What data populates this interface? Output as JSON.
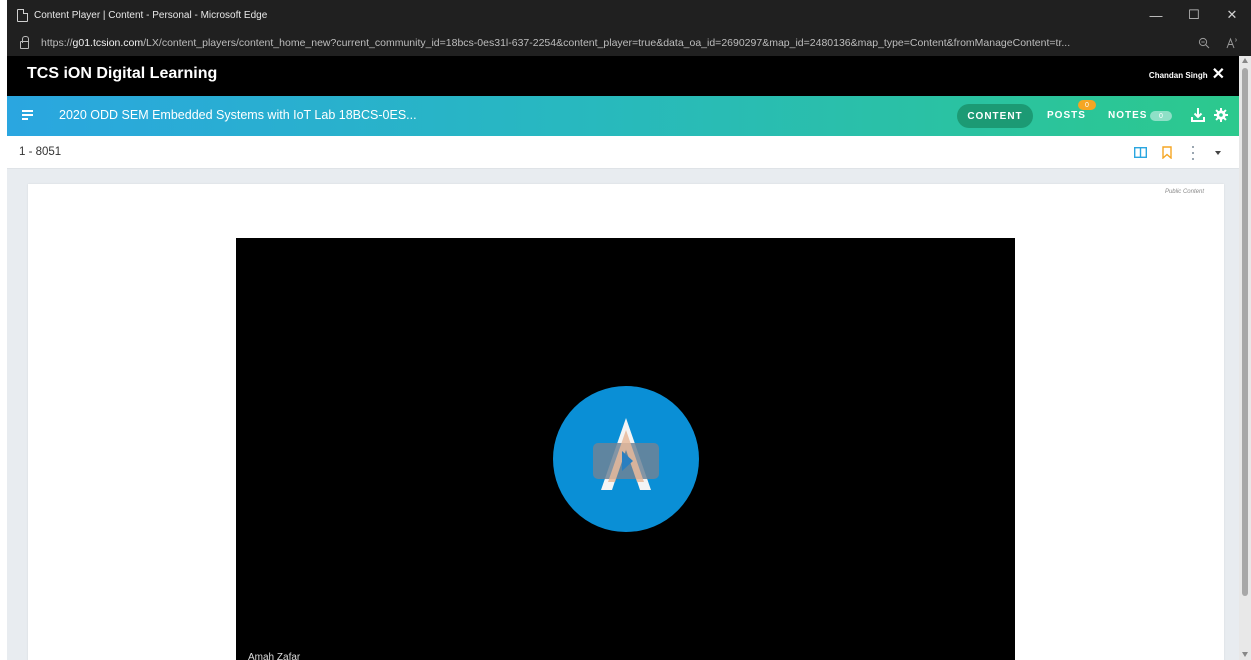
{
  "window": {
    "title": "Content Player | Content - Personal - Microsoft Edge",
    "controls": {
      "minimize": "—",
      "maximize": "☐",
      "close": "✕"
    }
  },
  "address_bar": {
    "url_prefix": "https://",
    "url_host": "g01.tcsion.com",
    "url_rest": "/LX/content_players/content_home_new?current_community_id=18bcs-0es31l-637-2254&content_player=true&data_oa_id=2690297&map_id=2480136&map_type=Content&fromManageContent=tr...",
    "icons": [
      "zoom-icon",
      "read-aloud-icon"
    ]
  },
  "site_header": {
    "brand": "TCS iON Digital Learning",
    "user_name": "Chandan Singh"
  },
  "course_bar": {
    "title": "2020 ODD SEM Embedded Systems with IoT Lab 18BCS-0ES...",
    "content_label": "CONTENT",
    "posts_label": "POSTS",
    "posts_count": "0",
    "notes_label": "NOTES",
    "notes_count": "0"
  },
  "sub_bar": {
    "breadcrumb": "1 - 8051"
  },
  "content_card": {
    "public_label": "Public Content",
    "video_caption": "Amah Zafar"
  },
  "colors": {
    "header_bg": "#000000",
    "gradient_start": "#2aa6e0",
    "gradient_end": "#2cc98d",
    "content_pill": "#1c9a74",
    "posts_badge": "#f5a623",
    "play_circle": "#0a8fd6",
    "bookmark": "#f5a623",
    "book": "#2aa6e0"
  }
}
